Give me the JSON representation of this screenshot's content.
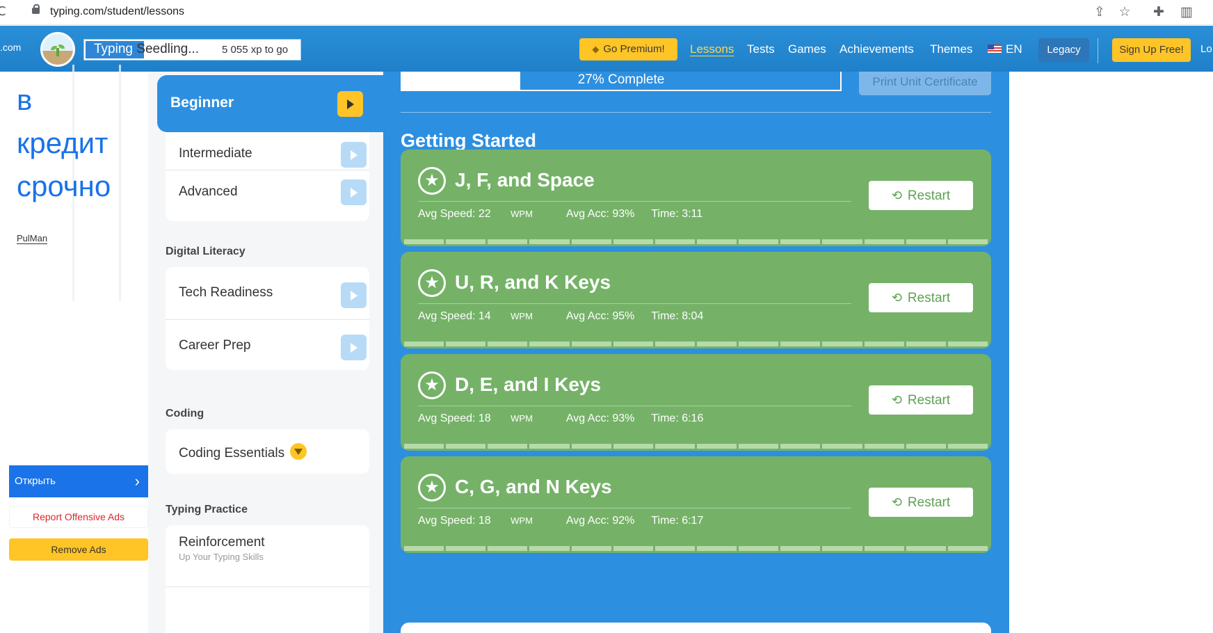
{
  "browser": {
    "url": "typing.com/student/lessons",
    "reload_glyph": "C",
    "share_glyph": "⇪",
    "star_glyph": "☆",
    "ext_glyph": "✚",
    "panel_glyph": "▥"
  },
  "header": {
    "logo_tail": ".com",
    "level_name_selected": "Typing ",
    "level_name_rest": "Seedling...",
    "xp_to_go": "5 055 xp to go",
    "premium_label": "Go Premium!",
    "nav": [
      "Lessons",
      "Tests",
      "Games",
      "Achievements",
      "Themes"
    ],
    "language": "EN",
    "legacy_label": "Legacy",
    "signup_label": "Sign Up Free!",
    "login_cut": "Lo"
  },
  "ad": {
    "line1": "в",
    "line2": "кредит",
    "line3": "срочно",
    "brand": "PulMan",
    "open_label": "Открыть",
    "chevron": "›",
    "report_label": "Report Offensive Ads",
    "remove_label": "Remove Ads"
  },
  "sidebar": {
    "active_label": "Beginner",
    "basic_items": [
      "Intermediate",
      "Advanced"
    ],
    "sections": {
      "digital_literacy": "Digital Literacy",
      "coding": "Coding",
      "typing_practice": "Typing Practice"
    },
    "digital_items": [
      "Tech Readiness",
      "Career Prep"
    ],
    "coding_item": "Coding Essentials",
    "practice_item": "Reinforcement",
    "practice_sub": "Up Your Typing Skills"
  },
  "main": {
    "progress_text": "27% Complete",
    "progress_fraction": 0.27,
    "print_label": "Print Unit Certificate",
    "unit_title": "Getting Started",
    "restart_label": "Restart",
    "restart_icon": "⟲",
    "star_icon": "★",
    "lessons": [
      {
        "name": "J, F, and Space",
        "speed_label": "Avg Speed: 22",
        "wpm": "WPM",
        "acc": "Avg Acc: 93%",
        "time": "Time: 3:11"
      },
      {
        "name": "U, R, and K Keys",
        "speed_label": "Avg Speed: 14",
        "wpm": "WPM",
        "acc": "Avg Acc: 95%",
        "time": "Time: 8:04"
      },
      {
        "name": "D, E, and I Keys",
        "speed_label": "Avg Speed: 18",
        "wpm": "WPM",
        "acc": "Avg Acc: 93%",
        "time": "Time: 6:16"
      },
      {
        "name": "C, G, and N Keys",
        "speed_label": "Avg Speed: 18",
        "wpm": "WPM",
        "acc": "Avg Acc: 92%",
        "time": "Time: 6:17"
      }
    ]
  },
  "colors": {
    "header_blue": "#2a8fd8",
    "main_blue": "#2d8fe0",
    "lesson_green": "#75b268",
    "accent_yellow": "#ffc425"
  }
}
